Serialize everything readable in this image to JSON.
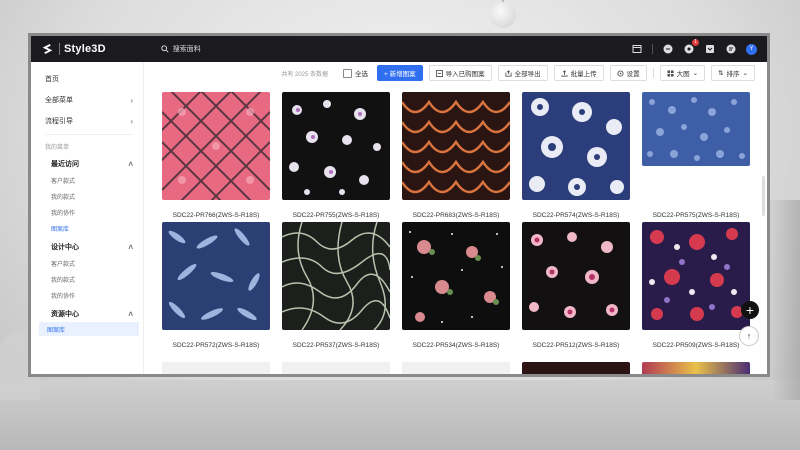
{
  "app": {
    "name": "Style3D"
  },
  "header": {
    "search_placeholder": "搜索面料",
    "icons": [
      "window-icon",
      "minus-circle-icon",
      "notification-icon",
      "archive-icon",
      "chat-icon",
      "user-avatar"
    ],
    "notification_badge": "1",
    "avatar_initial": "Y"
  },
  "sidebar": {
    "home": "首页",
    "all_menu": "全部菜单",
    "process_guide": "流程引导",
    "my_menu": "我的菜单",
    "groups": [
      {
        "label": "最近访问",
        "items": [
          "客户款式",
          "我的款式",
          "我的协作",
          "图案库"
        ]
      },
      {
        "label": "设计中心",
        "items": [
          "客户款式",
          "我的款式",
          "我的协作"
        ]
      },
      {
        "label": "资源中心",
        "items": [
          "图案库"
        ]
      }
    ],
    "active_item": "图案库"
  },
  "toolbar": {
    "count_text": "共有 2025 条数据",
    "select_all": "全选",
    "new_pattern": "+ 新增图案",
    "import_bought": "导入已购图案",
    "export_all": "全部导出",
    "batch_upload": "批量上传",
    "settings": "设置",
    "view_size": "大图",
    "sort": "排序"
  },
  "patterns": [
    {
      "name": "SDC22-PR766(ZWS-S-R18S)"
    },
    {
      "name": "SDC22-PR755(ZWS-S-R18S)"
    },
    {
      "name": "SDC22-PR683(ZWS-S-R18S)"
    },
    {
      "name": "SDC22-PR574(ZWS-S-R18S)"
    },
    {
      "name": "SDC22-PR575(ZWS-S-R18S)"
    },
    {
      "name": "SDC22-PR572(ZWS-S-R18S)"
    },
    {
      "name": "SDC22-PR537(ZWS-S-R18S)"
    },
    {
      "name": "SDC22-PR534(ZWS-S-R18S)"
    },
    {
      "name": "SDC22-PR512(ZWS-S-R18S)"
    },
    {
      "name": "SDC22-PR509(ZWS-S-R18S)"
    }
  ],
  "colors": {
    "accent": "#2f6ff0",
    "topbar": "#1b1b1f"
  }
}
